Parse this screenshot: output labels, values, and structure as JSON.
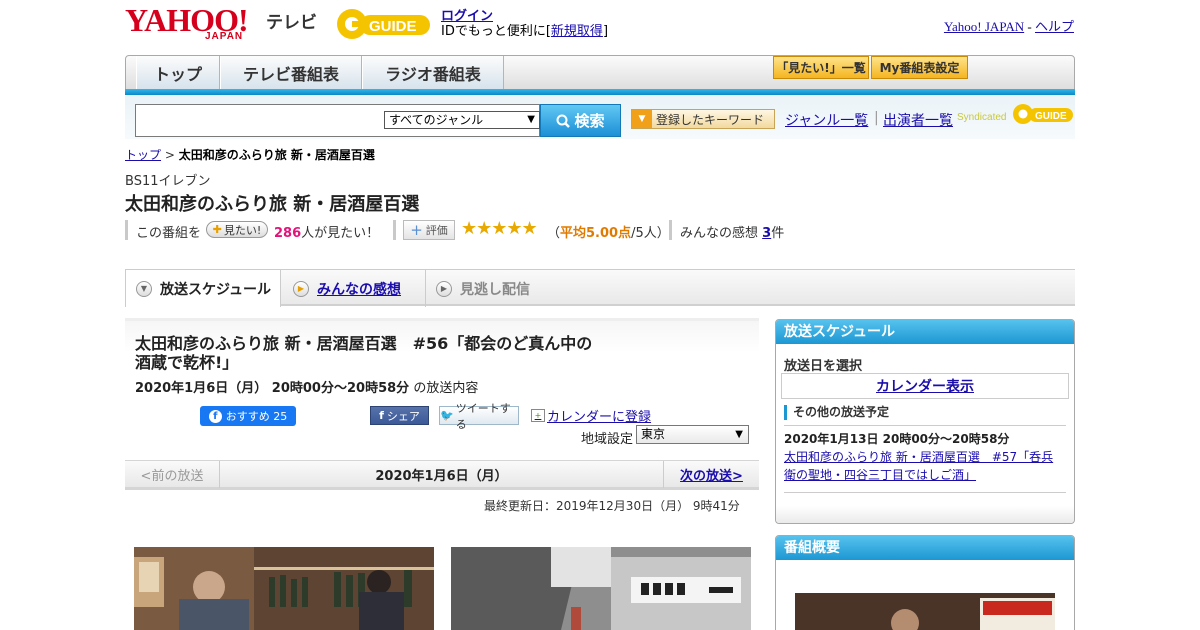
{
  "header": {
    "yahoo_logo_text": "YAHOO!",
    "yahoo_logo_sub": "JAPAN",
    "tv_label": "テレビ",
    "gguide_logo_text": "GUIDE",
    "login_label": "ログイン",
    "login_desc_prefix": "IDでもっと便利に[",
    "signup_label": "新規取得",
    "login_desc_suffix": "]",
    "yahoo_japan_link": "Yahoo! JAPAN",
    "dash": "-",
    "help_link": "ヘルプ"
  },
  "nav": {
    "tabs": [
      {
        "label": "トップ"
      },
      {
        "label": "テレビ番組表"
      },
      {
        "label": "ラジオ番組表"
      }
    ],
    "mitai_list_label": "「見たい!」一覧",
    "my_schedule_label": "My番組表設定"
  },
  "search": {
    "input_value": "",
    "genre_selected": "すべてのジャンル",
    "search_button": "検索",
    "keyword_button": "登録したキーワード",
    "genre_list_link": "ジャンル一覧",
    "separator": "|",
    "cast_list_link": "出演者一覧",
    "syndicated_label": "Syndicated"
  },
  "breadcrumb": {
    "top": "トップ",
    "sep": " > ",
    "current": "太田和彦のふらり旅 新・居酒屋百選"
  },
  "program": {
    "channel": "BS11イレブン",
    "title": "太田和彦のふらり旅 新・居酒屋百選",
    "mitai_prefix": "この番組を",
    "mitai_button": "見たい!",
    "mitai_count": "286",
    "mitai_suffix": "人が見たい！",
    "hyoka_button": "評価",
    "stars": "★★★★★",
    "rating_open": "（",
    "rating_avg": "平均5.00点",
    "rating_count": "/5人）",
    "impressions_prefix": "みんなの感想",
    "impressions_count": "3",
    "impressions_suffix": "件"
  },
  "tabs": {
    "schedule": "放送スケジュール",
    "impressions": "みんなの感想",
    "missed": "見逃し配信"
  },
  "episode": {
    "title": "太田和彦のふらり旅 新・居酒屋百選　#56「都会のど真ん中の酒蔵で乾杯!」",
    "date_time": "2020年1月6日（月） 20時00分～20時58分",
    "date_suffix": "の放送内容",
    "fb_label": "おすすめ 25",
    "share_label": "シェア",
    "tweet_label": "ツイートする",
    "calendar_link": "カレンダーに登録",
    "area_label": "地域設定",
    "area_selected": "東京",
    "prev_label": "<前の放送",
    "current_date": "2020年1月6日（月）",
    "next_label": "次の放送>",
    "updated": "最終更新日：2019年12月30日（月） 9時41分"
  },
  "sidebar": {
    "schedule_head": "放送スケジュール",
    "select_date": "放送日を選択",
    "calendar_view": "カレンダー表示",
    "other_head": "その他の放送予定",
    "other_date": "2020年1月13日 20時00分～20時58分",
    "other_link": "太田和彦のふらり旅 新・居酒屋百選　#57「呑兵衛の聖地・四谷三丁目ではしご酒」",
    "overview_head": "番組概要"
  },
  "colors": {
    "accent_blue": "#1c97d2",
    "link": "#1a0dab",
    "pink_count": "#e2147a",
    "rating_orange": "#e07b00",
    "star": "#e8a900"
  }
}
